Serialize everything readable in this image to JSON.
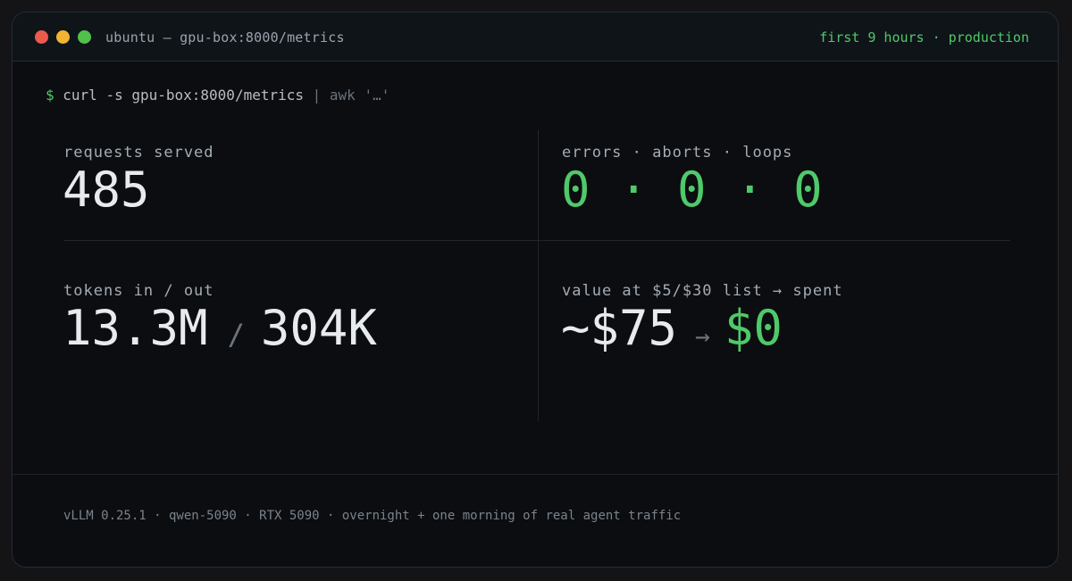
{
  "window": {
    "title": "ubuntu — gpu-box:8000/metrics",
    "status": "first 9 hours · production"
  },
  "command": {
    "prompt": "$",
    "text": "curl -s gpu-box:8000/metrics",
    "pipe": "| awk '…'"
  },
  "metrics": {
    "requests": {
      "label": "requests served",
      "value": "485"
    },
    "errors": {
      "label": "errors · aborts · loops",
      "value": "0 · 0 · 0"
    },
    "tokens": {
      "label": "tokens in / out",
      "in": "13.3M",
      "separator": "/",
      "out": "304K"
    },
    "value": {
      "label": "value at $5/$30 list → spent",
      "list_value": "~$75",
      "arrow": "→",
      "spent": "$0"
    }
  },
  "footer": {
    "text": "vLLM 0.25.1 · qwen-5090 · RTX 5090 · overnight + one morning of real agent traffic"
  },
  "colors": {
    "accent_green": "#4fc969",
    "background": "#0b0d10",
    "titlebar": "#0f1419"
  }
}
